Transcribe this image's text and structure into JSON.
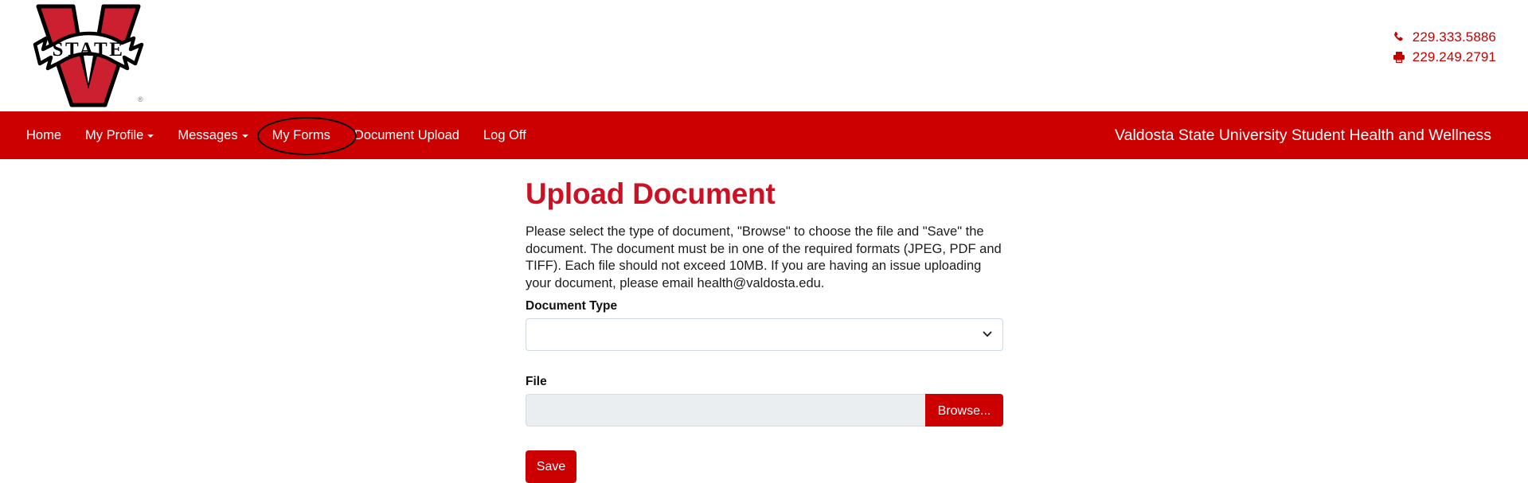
{
  "header": {
    "logo": {
      "name": "valdosta-state-v-logo",
      "banner_text": "STATE",
      "trademark": "®",
      "red": "#cc2031",
      "outline": "#000000"
    },
    "contact": [
      {
        "icon": "phone-icon",
        "number": "229.333.5886"
      },
      {
        "icon": "fax-icon",
        "number": "229.249.2791"
      }
    ],
    "contact_color": "#c80000"
  },
  "nav": {
    "background": "#cc0000",
    "items": [
      {
        "label": "Home",
        "has_caret": false,
        "name": "nav-item-home"
      },
      {
        "label": "My Profile",
        "has_caret": true,
        "name": "nav-item-my-profile"
      },
      {
        "label": "Messages",
        "has_caret": true,
        "name": "nav-item-messages"
      },
      {
        "label": "My Forms",
        "has_caret": false,
        "name": "nav-item-my-forms"
      },
      {
        "label": "Document Upload",
        "has_caret": false,
        "name": "nav-item-document-upload"
      },
      {
        "label": "Log Off",
        "has_caret": false,
        "name": "nav-item-log-off"
      }
    ],
    "brand_text": "Valdosta State University Student Health and Wellness",
    "annotation": {
      "type": "ellipse-highlight",
      "target": "Document Upload",
      "color": "#000000"
    }
  },
  "main": {
    "title": "Upload Document",
    "title_color": "#cc1124",
    "intro": "Please select the type of document, \"Browse\" to choose the file and \"Save\" the document. The document must be in one of the required formats (JPEG, PDF and TIFF). Each file should not exceed 10MB. If you are having an issue uploading your document, please email health@valdosta.edu.",
    "document_type": {
      "label": "Document Type",
      "selected_value": "",
      "chevron_icon": "chevron-down-icon"
    },
    "file": {
      "label": "File",
      "input_value": "",
      "browse_label": "Browse..."
    },
    "save_label": "Save",
    "button_color": "#cc0000"
  }
}
